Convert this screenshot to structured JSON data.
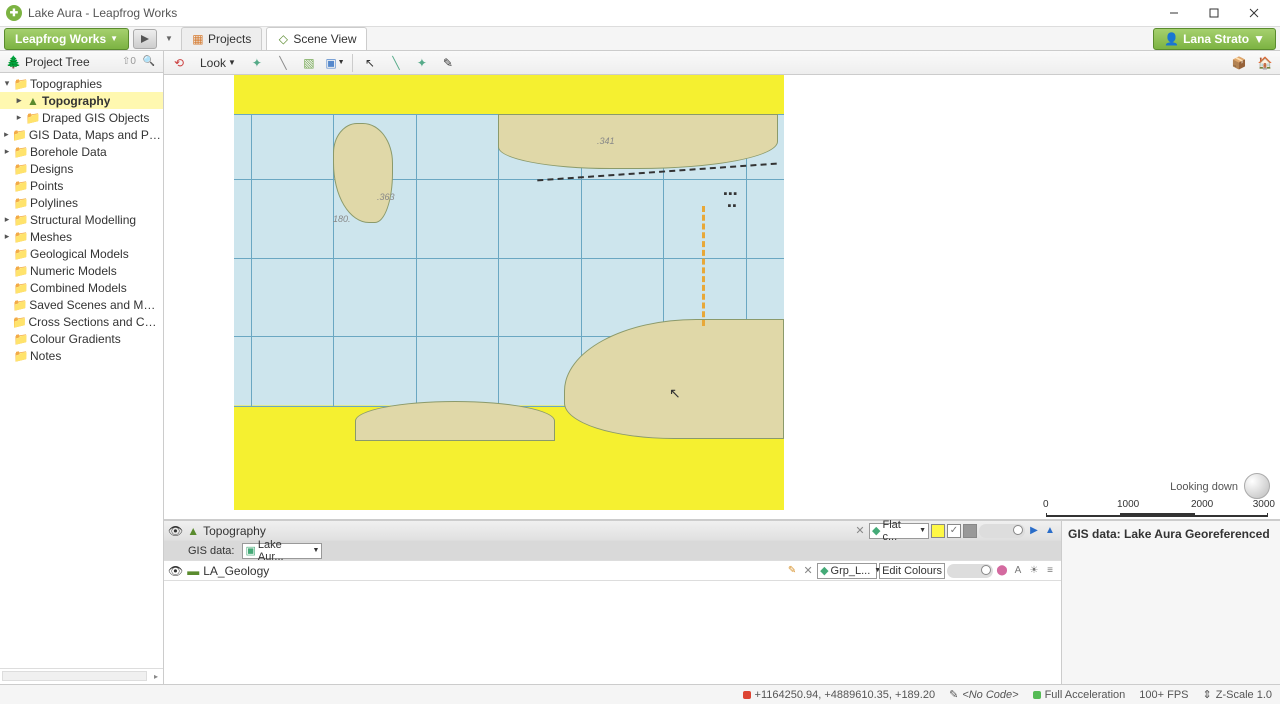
{
  "title": "Lake Aura - Leapfrog Works",
  "brand": "Leapfrog Works",
  "user": "Lana Strato",
  "tabs": {
    "projects": "Projects",
    "scene": "Scene View"
  },
  "sidebar": {
    "header": "Project Tree",
    "count": "0",
    "items": [
      {
        "label": "Topographies",
        "id": "topographies"
      },
      {
        "label": "Topography",
        "id": "topography"
      },
      {
        "label": "Draped GIS Objects",
        "id": "draped-gis"
      },
      {
        "label": "GIS Data, Maps and Photos",
        "id": "gis-data"
      },
      {
        "label": "Borehole Data",
        "id": "borehole"
      },
      {
        "label": "Designs",
        "id": "designs"
      },
      {
        "label": "Points",
        "id": "points"
      },
      {
        "label": "Polylines",
        "id": "polylines"
      },
      {
        "label": "Structural Modelling",
        "id": "structural"
      },
      {
        "label": "Meshes",
        "id": "meshes"
      },
      {
        "label": "Geological Models",
        "id": "geo-models"
      },
      {
        "label": "Numeric Models",
        "id": "num-models"
      },
      {
        "label": "Combined Models",
        "id": "combined"
      },
      {
        "label": "Saved Scenes and Movies",
        "id": "scenes"
      },
      {
        "label": "Cross Sections and Contours",
        "id": "cross"
      },
      {
        "label": "Colour Gradients",
        "id": "gradients"
      },
      {
        "label": "Notes",
        "id": "notes"
      }
    ]
  },
  "scene_toolbar": {
    "look": "Look"
  },
  "viewport": {
    "looking": "Looking down",
    "map_labels": {
      "a": ".363",
      "b": ".341",
      "c": "180."
    },
    "scale": {
      "s0": "0",
      "s1": "1000",
      "s2": "2000",
      "s3": "3000"
    }
  },
  "shape_list": {
    "row1": {
      "name": "Topography",
      "flat": "Flat c..."
    },
    "gis": {
      "label": "GIS data:",
      "value": "Lake Aur..."
    },
    "row2": {
      "name": "LA_Geology",
      "grp": "Grp_L...",
      "edit": "Edit Colours"
    }
  },
  "detail": {
    "label": "GIS data:",
    "value": "Lake Aura Georeferenced"
  },
  "status": {
    "coords": "+1164250.94, +4889610.35, +189.20",
    "code": "<No Code>",
    "accel": "Full Acceleration",
    "fps": "100+ FPS",
    "zscale": "Z-Scale 1.0"
  },
  "colors": {
    "yellow": "#f5f030",
    "chip_yellow": "#fff845"
  }
}
